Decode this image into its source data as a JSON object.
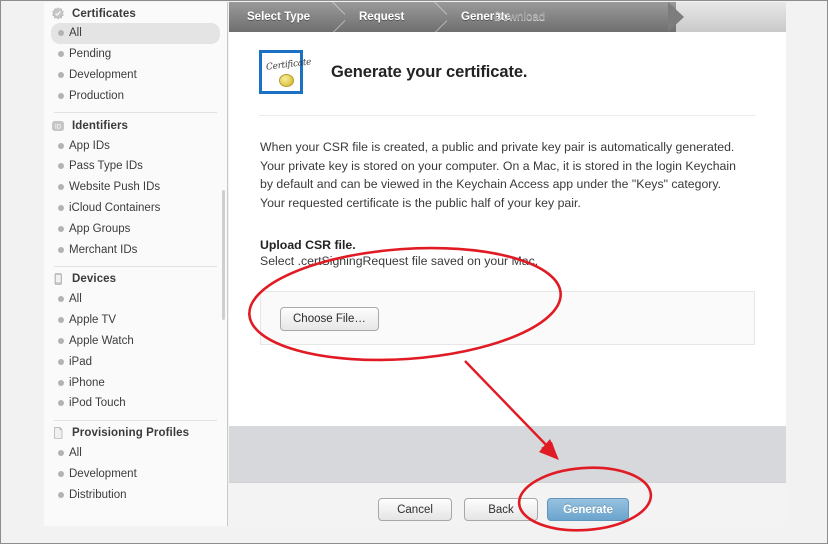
{
  "sidebar": {
    "sections": [
      {
        "title": "Certificates",
        "icon": "certificate-seal-icon",
        "items": [
          {
            "label": "All",
            "selected": true
          },
          {
            "label": "Pending",
            "selected": false
          },
          {
            "label": "Development",
            "selected": false
          },
          {
            "label": "Production",
            "selected": false
          }
        ]
      },
      {
        "title": "Identifiers",
        "icon": "id-badge-icon",
        "items": [
          {
            "label": "App IDs",
            "selected": false
          },
          {
            "label": "Pass Type IDs",
            "selected": false
          },
          {
            "label": "Website Push IDs",
            "selected": false
          },
          {
            "label": "iCloud Containers",
            "selected": false
          },
          {
            "label": "App Groups",
            "selected": false
          },
          {
            "label": "Merchant IDs",
            "selected": false
          }
        ]
      },
      {
        "title": "Devices",
        "icon": "device-phone-icon",
        "items": [
          {
            "label": "All",
            "selected": false
          },
          {
            "label": "Apple TV",
            "selected": false
          },
          {
            "label": "Apple Watch",
            "selected": false
          },
          {
            "label": "iPad",
            "selected": false
          },
          {
            "label": "iPhone",
            "selected": false
          },
          {
            "label": "iPod Touch",
            "selected": false
          }
        ]
      },
      {
        "title": "Provisioning Profiles",
        "icon": "document-icon",
        "items": [
          {
            "label": "All",
            "selected": false
          },
          {
            "label": "Development",
            "selected": false
          },
          {
            "label": "Distribution",
            "selected": false
          }
        ]
      }
    ]
  },
  "breadcrumb": {
    "steps": [
      {
        "label": "Select Type",
        "state": "done"
      },
      {
        "label": "Request",
        "state": "done"
      },
      {
        "label": "Generate",
        "state": "current"
      },
      {
        "label": "Download",
        "state": "inactive"
      }
    ]
  },
  "main": {
    "icon": "certificate-icon",
    "icon_word": "Certificate",
    "title": "Generate your certificate.",
    "body": "When your CSR file is created, a public and private key pair is automatically generated. Your private key is stored on your computer. On a Mac, it is stored in the login Keychain by default and can be viewed in the Keychain Access app under the \"Keys\" category. Your requested certificate is the public half of your key pair.",
    "upload_heading": "Upload CSR file.",
    "upload_sub": "Select .certSigningRequest file saved on your Mac.",
    "choose_file_label": "Choose File…"
  },
  "footer": {
    "cancel_label": "Cancel",
    "back_label": "Back",
    "generate_label": "Generate"
  },
  "colors": {
    "primary_button": "#6ba4cd",
    "annotation": "#e01b24",
    "certificate_border": "#1b72c4",
    "gray_band": "#d6d8db"
  },
  "annotations": {
    "ellipse_upload": "highlight-upload-area",
    "ellipse_generate": "highlight-generate-button",
    "arrow": "arrow-pointing-to-generate"
  }
}
